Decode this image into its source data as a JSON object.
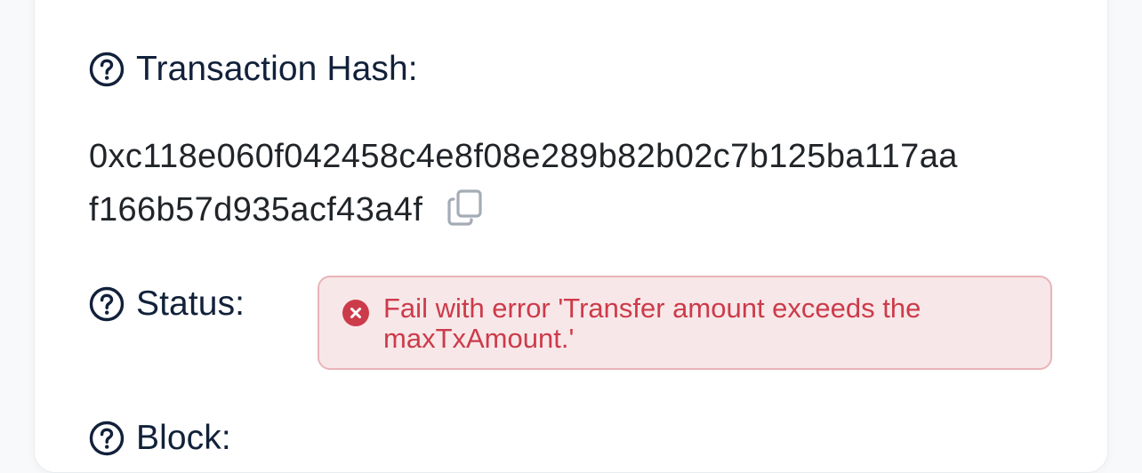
{
  "transaction_hash": {
    "label": "Transaction Hash:",
    "value_line_1": "0xc118e060f042458c4e8f08e289b82b02c7b125ba117aa",
    "value_line_2": "f166b57d935acf43a4f",
    "help_icon": "question-circle-icon",
    "copy_icon": "copy-icon"
  },
  "status": {
    "label": "Status:",
    "help_icon": "question-circle-icon",
    "error_icon": "x-circle-icon",
    "message": "Fail with error 'Transfer amount exceeds the maxTxAmount.'"
  },
  "block": {
    "label": "Block:",
    "help_icon": "question-circle-icon"
  },
  "colors": {
    "label_text": "#12213a",
    "error_text": "#cc3b4a",
    "error_bg": "#f8e7e8",
    "error_border": "#e9b4b9",
    "copy_icon": "#a5acb5"
  }
}
